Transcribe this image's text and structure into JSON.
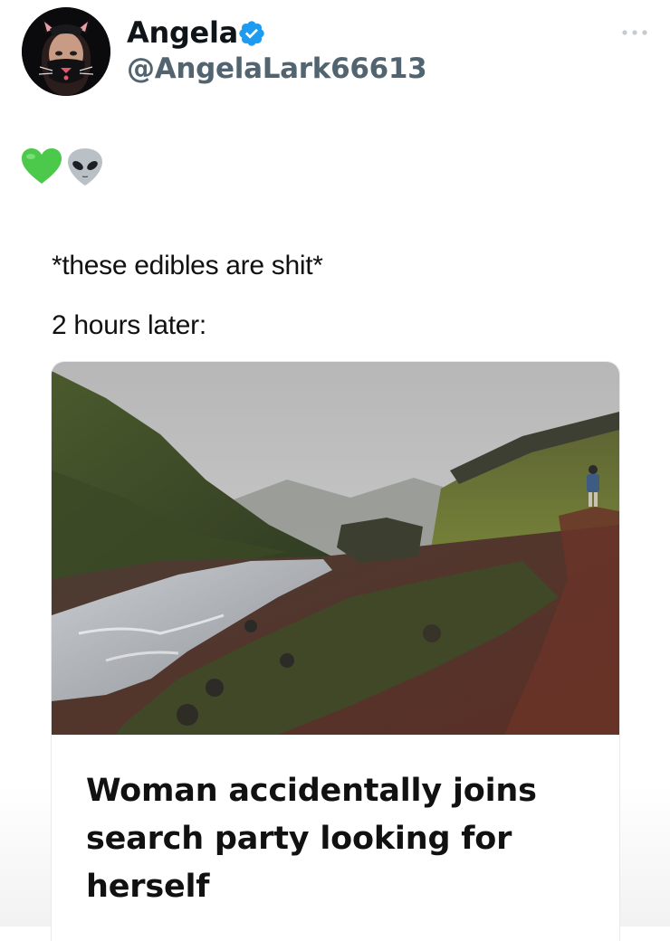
{
  "tweet": {
    "author": {
      "display_name": "Angela",
      "handle": "@AngelaLark66613",
      "verified": true,
      "avatar_icon": "cat-mask-avatar"
    },
    "more_icon": "ellipsis-icon",
    "emojis": [
      "green-heart",
      "alien"
    ],
    "meme": {
      "caption_top": "*these edibles are shit*",
      "caption_bottom": "2 hours later:",
      "headline": "Woman accidentally joins search party looking for herself",
      "photo_description": ""
    }
  },
  "colors": {
    "text": "#0f1419",
    "secondary": "#536471",
    "verified": "#1d9bf0",
    "heart": "#4cc94a"
  }
}
